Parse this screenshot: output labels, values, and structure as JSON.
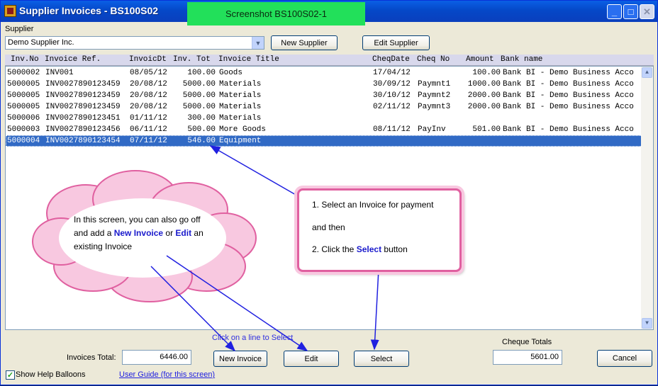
{
  "window": {
    "title": "Supplier Invoices - BS100S02",
    "badge": "Screenshot BS100S02-1",
    "minimize_glyph": "_",
    "maximize_glyph": "□",
    "close_glyph": "✕"
  },
  "supplier": {
    "label": "Supplier",
    "value": "Demo Supplier Inc.",
    "new_button": "New Supplier",
    "edit_button": "Edit Supplier"
  },
  "grid": {
    "columns": [
      "Inv.No",
      "Invoice Ref.",
      "InvoicDt",
      "Inv. Tot",
      "Invoice Title",
      "CheqDate",
      "Cheq No",
      "Amount",
      "Bank name"
    ],
    "rows": [
      {
        "inv_no": "5000002",
        "ref": "INV001",
        "date": "08/05/12",
        "total": "100.00",
        "title": "Goods",
        "cheq_date": "17/04/12",
        "cheq_no": "",
        "amount": "100.00",
        "bank": "Bank BI - Demo Business Acco"
      },
      {
        "inv_no": "5000005",
        "ref": "INV0027890123459",
        "date": "20/08/12",
        "total": "5000.00",
        "title": "Materials",
        "cheq_date": "30/09/12",
        "cheq_no": "Paymnt1",
        "amount": "1000.00",
        "bank": "Bank BI - Demo Business Acco"
      },
      {
        "inv_no": "5000005",
        "ref": "INV0027890123459",
        "date": "20/08/12",
        "total": "5000.00",
        "title": "Materials",
        "cheq_date": "30/10/12",
        "cheq_no": "Paymnt2",
        "amount": "2000.00",
        "bank": "Bank BI - Demo Business Acco"
      },
      {
        "inv_no": "5000005",
        "ref": "INV0027890123459",
        "date": "20/08/12",
        "total": "5000.00",
        "title": "Materials",
        "cheq_date": "02/11/12",
        "cheq_no": "Paymnt3",
        "amount": "2000.00",
        "bank": "Bank BI - Demo Business Acco"
      },
      {
        "inv_no": "5000006",
        "ref": "INV0027890123451",
        "date": "01/11/12",
        "total": "300.00",
        "title": "Materials",
        "cheq_date": "",
        "cheq_no": "",
        "amount": "",
        "bank": ""
      },
      {
        "inv_no": "5000003",
        "ref": "INV0027890123456",
        "date": "06/11/12",
        "total": "500.00",
        "title": "More Goods",
        "cheq_date": "08/11/12",
        "cheq_no": "PayInv",
        "amount": "501.00",
        "bank": "Bank BI - Demo Business Acco"
      },
      {
        "inv_no": "5000004",
        "ref": "INV0027890123454",
        "date": "07/11/12",
        "total": "546.00",
        "title": "Equipment",
        "cheq_date": "",
        "cheq_no": "",
        "amount": "",
        "bank": "",
        "selected": true
      }
    ]
  },
  "footer": {
    "hint": "Click on a line to Select",
    "invoices_total_label": "Invoices Total:",
    "invoices_total": "6446.00",
    "new_invoice_button": "New Invoice",
    "edit_button": "Edit",
    "select_button": "Select",
    "cheque_totals_label": "Cheque Totals",
    "cheque_total": "5601.00",
    "cancel_button": "Cancel",
    "show_help_label": "Show Help Balloons",
    "user_guide_link": "User Guide (for this screen)"
  },
  "help": {
    "cloud_pre": "In this screen, you can also go off and add a ",
    "cloud_new": "New Invoice",
    "cloud_mid": " or ",
    "cloud_edit": "Edit",
    "cloud_post": " an existing Invoice",
    "callout_line1": "1. Select an Invoice for payment",
    "callout_line2": "and then",
    "callout_line3_pre": "2. Click the ",
    "callout_line3_sel": "Select",
    "callout_line3_post": " button"
  },
  "colors": {
    "selection": "#316ac5",
    "badge": "#22e05a",
    "callout_border": "#e060a0",
    "arrow": "#2020e0"
  }
}
